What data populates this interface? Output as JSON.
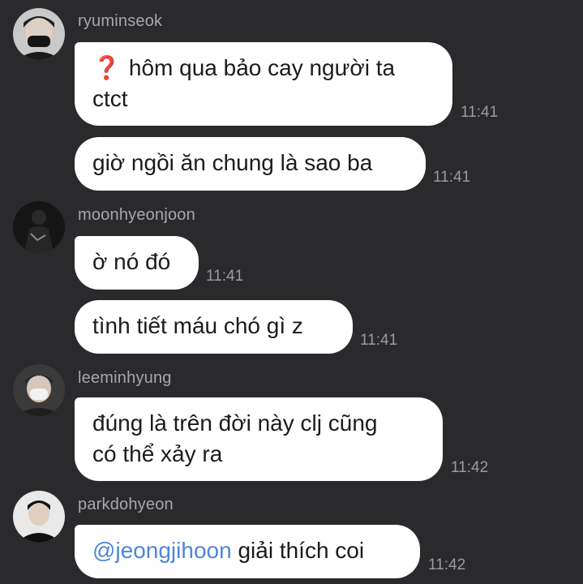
{
  "messages": [
    {
      "user": "ryuminseok",
      "bubbles": [
        {
          "emoji": "❓",
          "text_line1": "hôm qua bảo cay người ta",
          "text_line2": "ctct",
          "time": "11:41"
        },
        {
          "text": "giờ ngồi ăn chung là sao ba",
          "time": "11:41"
        }
      ]
    },
    {
      "user": "moonhyeonjoon",
      "bubbles": [
        {
          "text": "ờ nó đó",
          "time": "11:41"
        },
        {
          "text": "tình tiết máu chó gì z",
          "time": "11:41"
        }
      ]
    },
    {
      "user": "leeminhyung",
      "bubbles": [
        {
          "text_line1": "đúng là trên đời này clj cũng",
          "text_line2": "có thể xảy ra",
          "time": "11:42"
        }
      ]
    },
    {
      "user": "parkdohyeon",
      "bubbles": [
        {
          "mention": "@jeongjihoon",
          "text": " giải thích coi",
          "time": "11:42"
        }
      ]
    }
  ]
}
